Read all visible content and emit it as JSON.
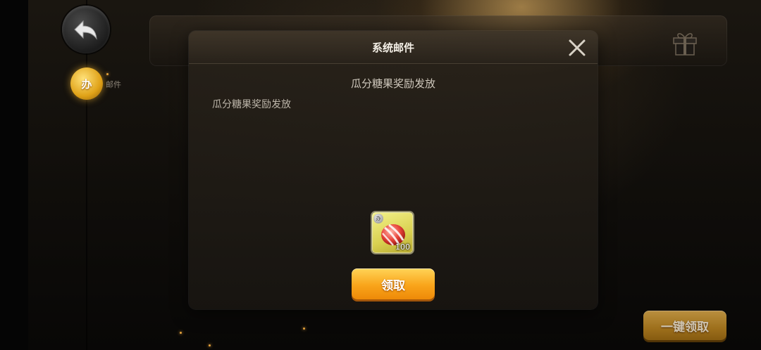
{
  "navigation": {
    "back_icon": "back-arrow-icon"
  },
  "sidebar": {
    "tabs": [
      {
        "label": "邮件",
        "icon": "mail-coin-icon",
        "icon_text": "办"
      }
    ]
  },
  "banner": {
    "gift_icon": "gift-box-icon"
  },
  "mail_dialog": {
    "title": "系统邮件",
    "close_icon": "close-icon",
    "subject": "瓜分糖果奖励发放",
    "body": "瓜分糖果奖励发放",
    "attachments": [
      {
        "icon": "candy-icon",
        "badge_text": "办",
        "count": "100"
      }
    ],
    "claim_label": "领取"
  },
  "footer": {
    "claim_all_label": "一键领取"
  },
  "colors": {
    "accent_orange": "#f9a41a",
    "modal_bg": "#1f1b16",
    "title_text": "#f4efe6"
  }
}
